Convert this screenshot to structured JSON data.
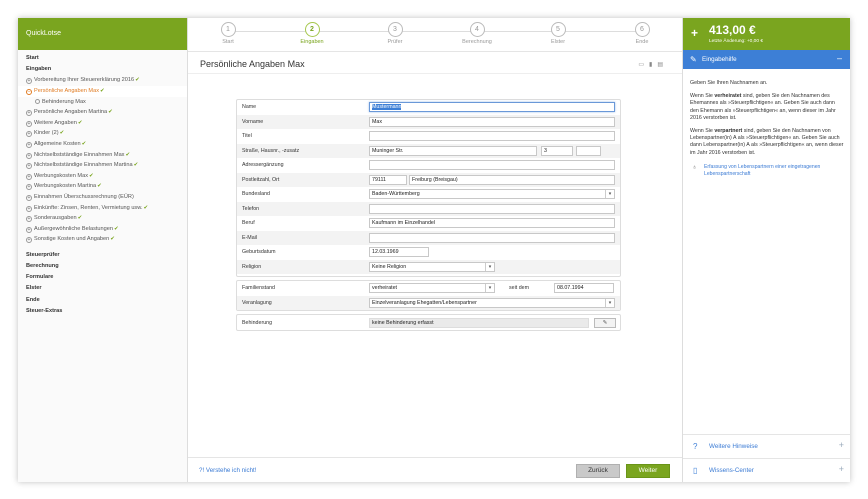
{
  "app": {
    "name": "QuickLotse"
  },
  "sidebar": {
    "sections_top": [
      "Start",
      "Eingaben"
    ],
    "items": [
      {
        "label": "Vorbereitung Ihrer Steuererklärung 2016",
        "toggle": "+",
        "check": true
      },
      {
        "label": "Persönliche Angaben Max",
        "toggle": "–",
        "check": true,
        "active": true
      },
      {
        "label": "Behinderung Max",
        "toggle": "",
        "check": false,
        "sub": true
      },
      {
        "label": "Persönliche Angaben Martina",
        "toggle": "+",
        "check": true
      },
      {
        "label": "Weitere Angaben",
        "toggle": "+",
        "check": true
      },
      {
        "label": "Kinder (2)",
        "toggle": "+",
        "check": true
      },
      {
        "label": "Allgemeine Kosten",
        "toggle": "+",
        "check": true
      },
      {
        "label": "Nichtselbstständige Einnahmen Max",
        "toggle": "+",
        "check": true
      },
      {
        "label": "Nichtselbstständige Einnahmen Martina",
        "toggle": "+",
        "check": true
      },
      {
        "label": "Werbungskosten Max",
        "toggle": "+",
        "check": true
      },
      {
        "label": "Werbungskosten Martina",
        "toggle": "+",
        "check": true
      },
      {
        "label": "Einnahmen Überschussrechnung (EÜR)",
        "toggle": "+",
        "check": false
      },
      {
        "label": "Einkünfte: Zinsen, Renten, Vermietung usw.",
        "toggle": "+",
        "check": true
      },
      {
        "label": "Sonderausgaben",
        "toggle": "+",
        "check": true
      },
      {
        "label": "Außergewöhnliche Belastungen",
        "toggle": "+",
        "check": true
      },
      {
        "label": "Sonstige Kosten und Angaben",
        "toggle": "+",
        "check": true
      }
    ],
    "sections_bottom": [
      "Steuerprüfer",
      "Berechnung",
      "Formulare",
      "Elster",
      "Ende",
      "Steuer-Extras"
    ]
  },
  "steps": [
    {
      "num": "1",
      "label": "Start"
    },
    {
      "num": "2",
      "label": "Eingaben",
      "current": true
    },
    {
      "num": "3",
      "label": "Prüfer"
    },
    {
      "num": "4",
      "label": "Berechnung"
    },
    {
      "num": "5",
      "label": "Elster"
    },
    {
      "num": "6",
      "label": "Ende"
    }
  ],
  "page": {
    "title": "Persönliche Angaben Max",
    "icons": [
      "comment-icon",
      "info-icon",
      "print-icon"
    ]
  },
  "form": {
    "name_label": "Name",
    "name_value": "Mustermann",
    "vorname_label": "Vorname",
    "vorname_value": "Max",
    "titel_label": "Titel",
    "titel_value": "",
    "strasse_label": "Straße, Hausnr., -zusatz",
    "strasse_value": "Muninger Str.",
    "hausnr_value": "3",
    "zusatz_value": "",
    "adress_label": "Adressergänzung",
    "adress_value": "",
    "plz_label": "Postleitzahl, Ort",
    "plz_value": "79111",
    "ort_value": "Freiburg (Breisgau)",
    "bundesland_label": "Bundesland",
    "bundesland_value": "Baden-Württemberg",
    "telefon_label": "Telefon",
    "telefon_value": "",
    "beruf_label": "Beruf",
    "beruf_value": "Kaufmann im Einzelhandel",
    "email_label": "E-Mail",
    "email_value": "",
    "geburt_label": "Geburtsdatum",
    "geburt_value": "12.03.1969",
    "religion_label": "Religion",
    "religion_value": "Keine Religion",
    "familienstand_label": "Familienstand",
    "familienstand_value": "verheiratet",
    "seit_label": "seit dem",
    "seit_value": "08.07.1994",
    "veranlagung_label": "Veranlagung",
    "veranlagung_value": "Einzelveranlagung Ehegatten/Lebenspartner",
    "behinderung_label": "Behinderung",
    "behinderung_value": "keine Behinderung erfasst"
  },
  "footer": {
    "help": "Verstehe ich nicht!",
    "back": "Zurück",
    "next": "Weiter"
  },
  "right": {
    "amount": "413,00 €",
    "last_change": "Letzte Änderung: +0,00 €",
    "help_title": "Eingabehilfe",
    "p1": "Geben Sie Ihren Nachnamen an.",
    "p2_a": "Wenn Sie ",
    "p2_b": "verheiratet",
    "p2_c": " sind, geben Sie den Nachnamen des Ehemannes als »Steuerpflichtigen« an. Geben Sie auch dann den Ehemann als »Steuerpflichtigen« an, wenn dieser im Jahr 2016 verstorben ist.",
    "p3_a": "Wenn Sie ",
    "p3_b": "verpartnert",
    "p3_c": " sind, geben Sie den Nachnamen von Lebenspartner(in) A als »Steuerpflichtigen« an. Geben Sie auch dann Lebenspartner(in) A als »Steuerpflichtigen« an, wenn dieser im Jahr 2016 verstorben ist.",
    "link": "Erfassung von Lebenspartnern einer eingetragenen Lebenspartnerschaft",
    "acc1": "Weitere Hinweise",
    "acc2": "Wissens-Center"
  },
  "colors": {
    "brand": "#7aa51f",
    "accent": "#3d7fd6",
    "active": "#e07b22"
  }
}
